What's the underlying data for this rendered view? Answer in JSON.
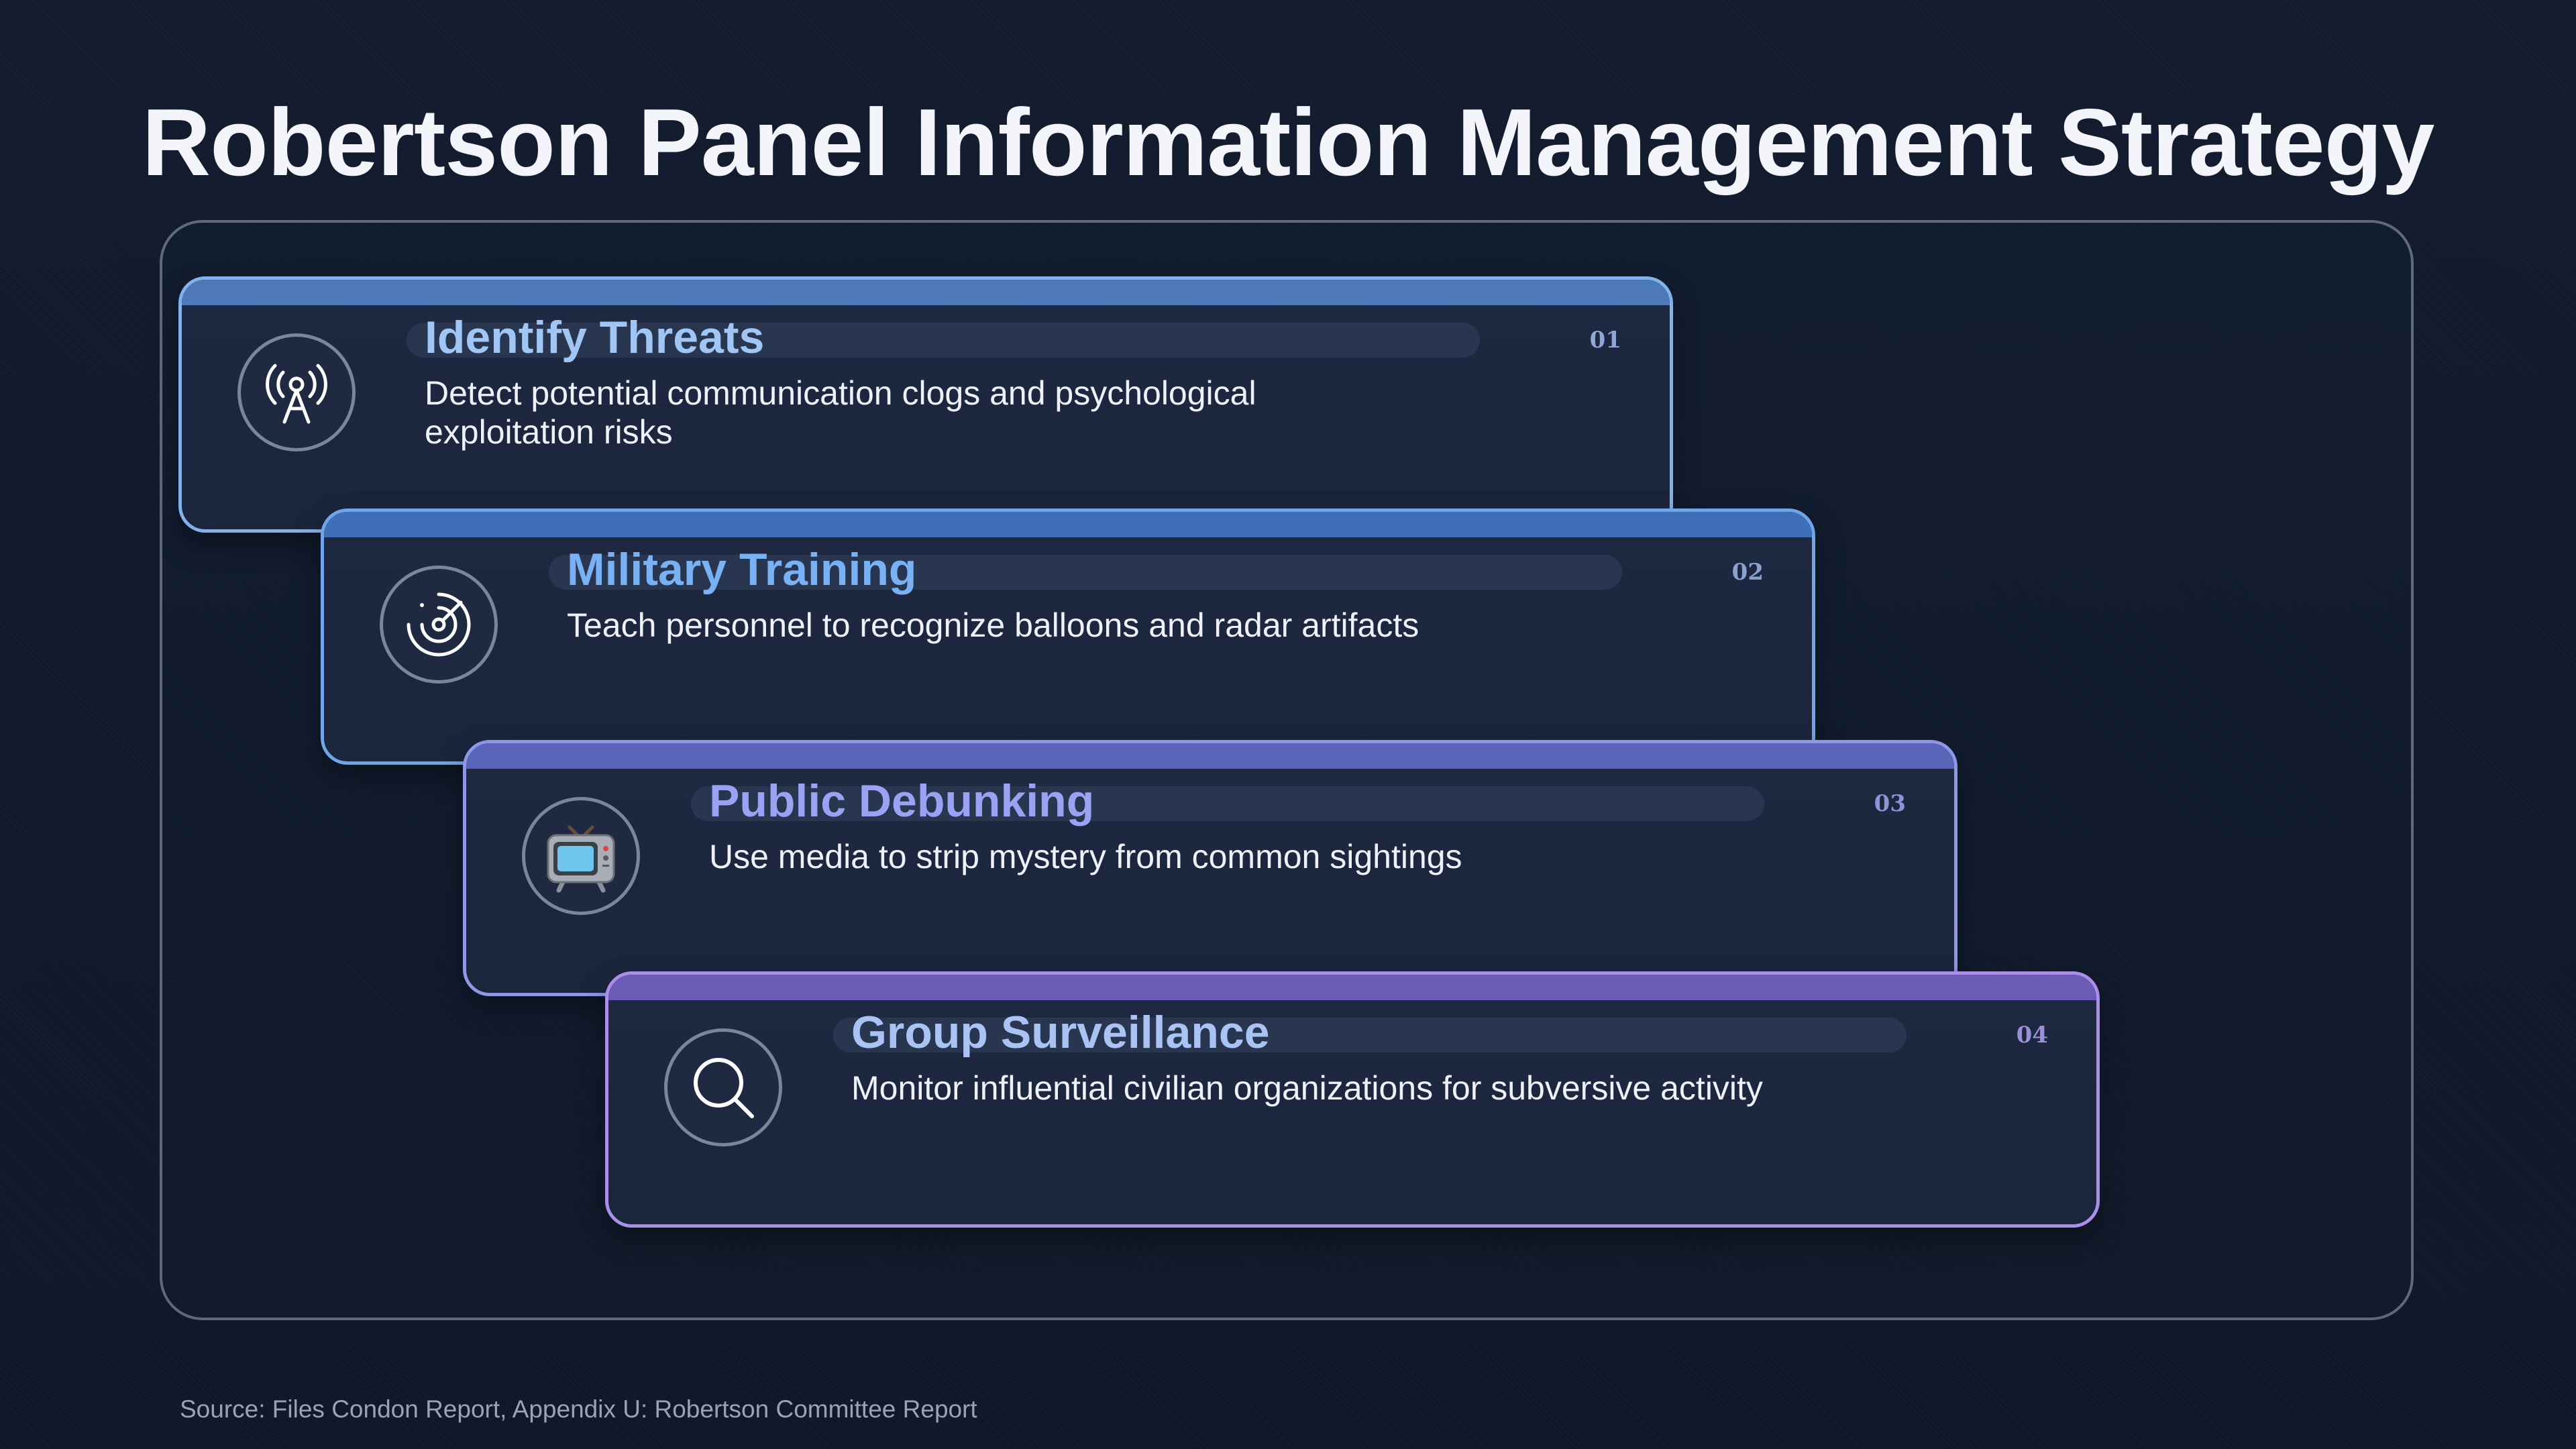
{
  "title": "Robertson Panel Information Management Strategy",
  "steps": [
    {
      "number": "01",
      "title": "Identify Threats",
      "description": "Detect potential communication clogs and psychological exploitation risks",
      "icon": "radio-tower-icon"
    },
    {
      "number": "02",
      "title": "Military Training",
      "description": "Teach personnel to recognize balloons and radar artifacts",
      "icon": "radar-icon"
    },
    {
      "number": "03",
      "title": "Public Debunking",
      "description": "Use media to strip mystery from common sightings",
      "icon": "television-icon"
    },
    {
      "number": "04",
      "title": "Group Surveillance",
      "description": "Monitor influential civilian organizations for subversive activity",
      "icon": "magnifying-glass-icon"
    }
  ],
  "source": "Source: Files Condon Report, Appendix U: Robertson Committee Report",
  "colors": {
    "background": "#121b2d",
    "step1_accent": "#82b2ea",
    "step2_accent": "#6fa6ea",
    "step3_accent": "#8f96e6",
    "step4_accent": "#a98fe8"
  }
}
